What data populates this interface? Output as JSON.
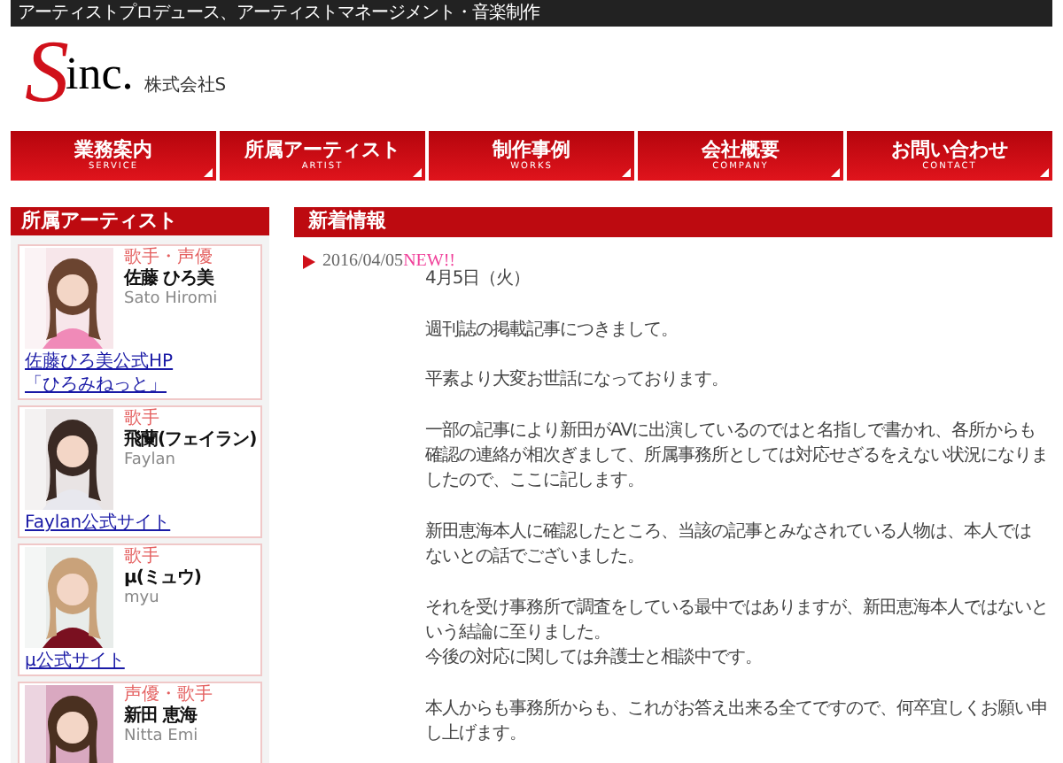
{
  "top_bar": {
    "text": "アーティストプロデュース、アーティストマネージメント・音楽制作"
  },
  "logo": {
    "mark": "S",
    "text": "inc.",
    "company": "株式会社S"
  },
  "nav": [
    {
      "label": "業務案内",
      "sub": "SERVICE"
    },
    {
      "label": "所属アーティスト",
      "sub": "ARTIST"
    },
    {
      "label": "制作事例",
      "sub": "WORKS"
    },
    {
      "label": "会社概要",
      "sub": "COMPANY"
    },
    {
      "label": "お問い合わせ",
      "sub": "CONTACT"
    }
  ],
  "sidebar": {
    "title": "所属アーティスト",
    "artists": [
      {
        "role": "歌手・声優",
        "name": "佐藤 ひろ美",
        "romaji": "Sato Hiromi",
        "links": [
          "佐藤ひろ美公式HP",
          "「ひろみねっと」"
        ],
        "photo": {
          "kind": "picture"
        }
      },
      {
        "role": "歌手",
        "name": "飛蘭(フェイラン)",
        "romaji": "Faylan",
        "links": [
          "Faylan公式サイト"
        ],
        "photo": {
          "kind": "picture"
        }
      },
      {
        "role": "歌手",
        "name": "μ(ミュウ)",
        "romaji": "myu",
        "links": [
          "μ公式サイト"
        ],
        "photo": {
          "kind": "picture"
        }
      },
      {
        "role": "声優・歌手",
        "name": "新田 恵海",
        "romaji": "Nitta Emi",
        "photo": {
          "kind": "picture"
        }
      }
    ]
  },
  "news": {
    "title": "新着情報",
    "items": [
      {
        "date": "2016/04/05",
        "badge": "NEW!!",
        "paragraphs": [
          [
            "4月5日（火）"
          ],
          [
            "週刊誌の掲載記事につきまして。"
          ],
          [
            "平素より大変お世話になっております。"
          ],
          [
            "一部の記事により新田がAVに出演しているのではと名指しで書かれ、各所からも",
            "確認の連絡が相次ぎまして、所属事務所としては対応せざるをえない状況になりま",
            "したので、ここに記します。"
          ],
          [
            "新田恵海本人に確認したところ、当該の記事とみなされている人物は、本人では",
            "ないとの話でございました。"
          ],
          [
            "それを受け事務所で調査をしている最中ではありますが、新田恵海本人ではないと",
            "いう結論に至りました。",
            "今後の対応に関しては弁護士と相談中です。"
          ],
          [
            "本人からも事務所からも、これがお答え出来る全てですので、何卒宜しくお願い申",
            "し上げます。"
          ]
        ]
      }
    ]
  }
}
